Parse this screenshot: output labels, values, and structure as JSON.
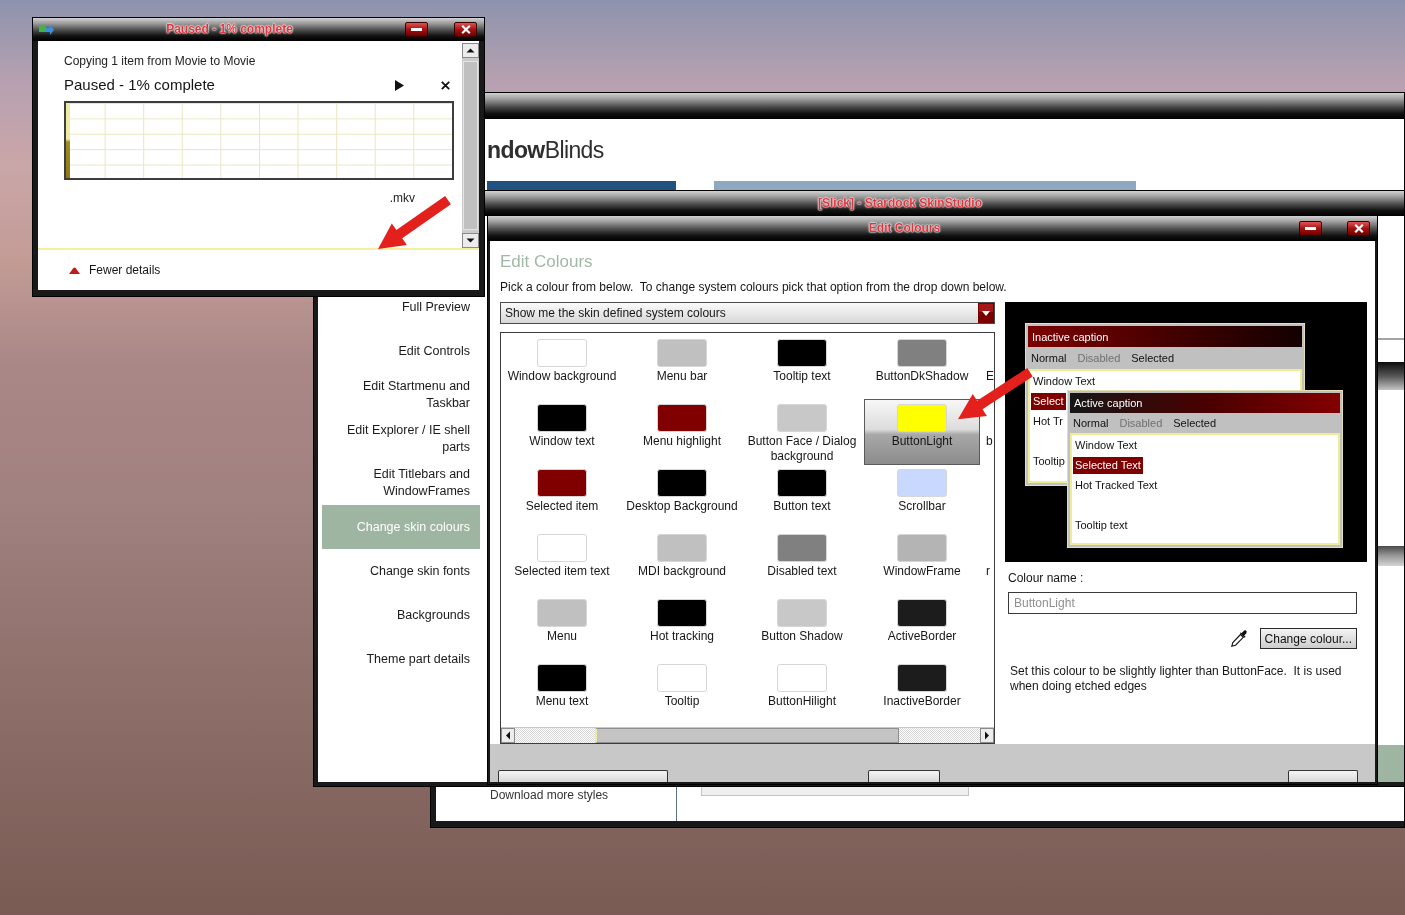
{
  "copy_dialog": {
    "title": "Paused - 1% complete",
    "header": "Copying 1 item from Movie to Movie",
    "status": "Paused - 1% complete",
    "progress": {
      "level": 0.01
    },
    "file_name": ".mkv",
    "details_toggle": {
      "label": "Fewer details",
      "expanded": true
    }
  },
  "background_window": {
    "logo": "**ndow**Blinds",
    "footer_link": "Download more styles"
  },
  "skin_studio": {
    "title": "[Slick] - Stardock SkinStudio",
    "sidebar": {
      "items": [
        {
          "label": "Full Preview",
          "selected": false
        },
        {
          "label": "Edit Controls",
          "selected": false
        },
        {
          "label": "Edit Startmenu and Taskbar",
          "selected": false
        },
        {
          "label": "Edit Explorer / IE shell parts",
          "selected": false
        },
        {
          "label": "Edit Titlebars and WindowFrames",
          "selected": false
        },
        {
          "label": "Change skin colours",
          "selected": true
        },
        {
          "label": "Change skin fonts",
          "selected": false
        },
        {
          "label": "Backgrounds",
          "selected": false
        },
        {
          "label": "Theme part details",
          "selected": false
        }
      ]
    }
  },
  "edit_colours": {
    "title": "Edit Colours",
    "heading": "Edit Colours",
    "instructions": "Pick a colour from below.  To change system colours pick that option from the drop down below.",
    "dropdown": {
      "value": "Show me the skin defined system colours"
    },
    "colour_grid": {
      "rows": [
        {
          "cells": [
            {
              "label": "Window background",
              "color": "#ffffff",
              "selected": false
            },
            {
              "label": "Menu bar",
              "color": "#c0c0c0",
              "selected": false
            },
            {
              "label": "Tooltip text",
              "color": "#000000",
              "selected": false
            },
            {
              "label": "ButtonDkShadow",
              "color": "#808080",
              "selected": false
            }
          ],
          "clipped_label": "E"
        },
        {
          "cells": [
            {
              "label": "Window text",
              "color": "#000000",
              "selected": false
            },
            {
              "label": "Menu highlight",
              "color": "#800000",
              "selected": false
            },
            {
              "label": "Button Face / Dialog background",
              "color": "#c8c8c8",
              "selected": false
            },
            {
              "label": "ButtonLight",
              "color": "#ffff00",
              "selected": true
            }
          ],
          "clipped_label": "b"
        },
        {
          "cells": [
            {
              "label": "Selected item",
              "color": "#800000",
              "selected": false
            },
            {
              "label": "Desktop Background",
              "color": "#000000",
              "selected": false
            },
            {
              "label": "Button text",
              "color": "#000000",
              "selected": false
            },
            {
              "label": "Scrollbar",
              "color": "#c8d8ff",
              "selected": false
            }
          ]
        },
        {
          "cells": [
            {
              "label": "Selected item text",
              "color": "#ffffff",
              "selected": false
            },
            {
              "label": "MDI background",
              "color": "#c0c0c0",
              "selected": false
            },
            {
              "label": "Disabled text",
              "color": "#808080",
              "selected": false
            },
            {
              "label": "WindowFrame",
              "color": "#b4b4b4",
              "selected": false
            }
          ],
          "clipped_label": "r"
        },
        {
          "cells": [
            {
              "label": "Menu",
              "color": "#c0c0c0",
              "selected": false
            },
            {
              "label": "Hot tracking",
              "color": "#000000",
              "selected": false
            },
            {
              "label": "Button Shadow",
              "color": "#c8c8c8",
              "selected": false
            },
            {
              "label": "ActiveBorder",
              "color": "#1c1c1c",
              "selected": false
            }
          ]
        },
        {
          "cells": [
            {
              "label": "Menu text",
              "color": "#000000",
              "selected": false
            },
            {
              "label": "Tooltip",
              "color": "#ffffff",
              "selected": false
            },
            {
              "label": "ButtonHilight",
              "color": "#ffffff",
              "selected": false
            },
            {
              "label": "InactiveBorder",
              "color": "#1c1c1c",
              "selected": false
            }
          ]
        }
      ]
    },
    "preview": {
      "windows": [
        {
          "kind": "inactive",
          "caption": "Inactive caption",
          "menu": [
            {
              "label": "Normal",
              "disabled": false
            },
            {
              "label": "Disabled",
              "disabled": true
            },
            {
              "label": "Selected",
              "disabled": false
            }
          ],
          "lines": [
            {
              "text": "Window Text",
              "kind": "text"
            },
            {
              "text": "Select",
              "kind": "selected"
            },
            {
              "text": "Hot Tr",
              "kind": "hot"
            },
            {
              "text": "Tooltip",
              "kind": "tooltip"
            }
          ]
        },
        {
          "kind": "active",
          "caption": "Active caption",
          "menu": [
            {
              "label": "Normal",
              "disabled": false
            },
            {
              "label": "Disabled",
              "disabled": true
            },
            {
              "label": "Selected",
              "disabled": false
            }
          ],
          "lines": [
            {
              "text": "Window Text",
              "kind": "text"
            },
            {
              "text": "Selected Text",
              "kind": "selected"
            },
            {
              "text": "Hot Tracked Text",
              "kind": "hot"
            },
            {
              "text": "Tooltip text",
              "kind": "tooltip"
            }
          ]
        }
      ]
    },
    "colour_name": {
      "label": "Colour name :",
      "value": "ButtonLight",
      "disabled": true
    },
    "change_button": "Change colour...",
    "description": "Set this colour to be slightly lighter than ButtonFace.  It is used when doing etched edges"
  }
}
